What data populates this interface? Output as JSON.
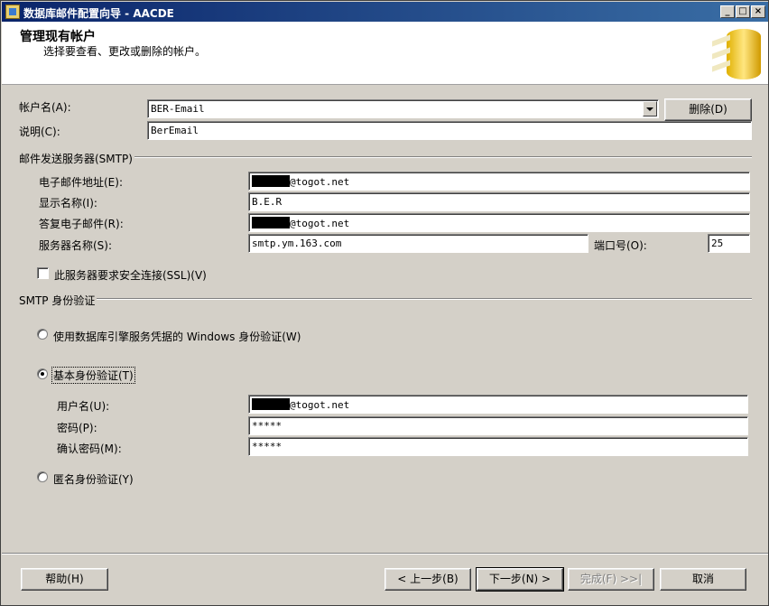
{
  "window": {
    "title": "数据库邮件配置向导 - AACDE",
    "minimize": "_",
    "maximize": "□",
    "close": "×"
  },
  "header": {
    "title": "管理现有帐户",
    "subtitle": "选择要查看、更改或删除的帐户。"
  },
  "account": {
    "name_label": "帐户名(A):",
    "name_value": "BER-Email",
    "delete_label": "删除(D)",
    "desc_label": "说明(C):",
    "desc_value": "BerEmail"
  },
  "smtp": {
    "group_label": "邮件发送服务器(SMTP)",
    "email_label": "电子邮件地址(E):",
    "email_suffix": "@togot.net",
    "display_label": "显示名称(I):",
    "display_value": "B.E.R",
    "reply_label": "答复电子邮件(R):",
    "reply_suffix": "@togot.net",
    "server_label": "服务器名称(S):",
    "server_value": "smtp.ym.163.com",
    "port_label": "端口号(O):",
    "port_value": "25",
    "ssl_label": "此服务器要求安全连接(SSL)(V)"
  },
  "auth": {
    "group_label": "SMTP 身份验证",
    "windows_label": "使用数据库引擎服务凭据的 Windows 身份验证(W)",
    "basic_label": "基本身份验证(T)",
    "user_label": "用户名(U):",
    "user_suffix": "@togot.net",
    "password_label": "密码(P):",
    "password_value": "*****",
    "confirm_label": "确认密码(M):",
    "confirm_value": "*****",
    "anonymous_label": "匿名身份验证(Y)"
  },
  "footer": {
    "help": "帮助(H)",
    "back": "< 上一步(B)",
    "next": "下一步(N) >",
    "finish": "完成(F) >>|",
    "cancel": "取消"
  }
}
